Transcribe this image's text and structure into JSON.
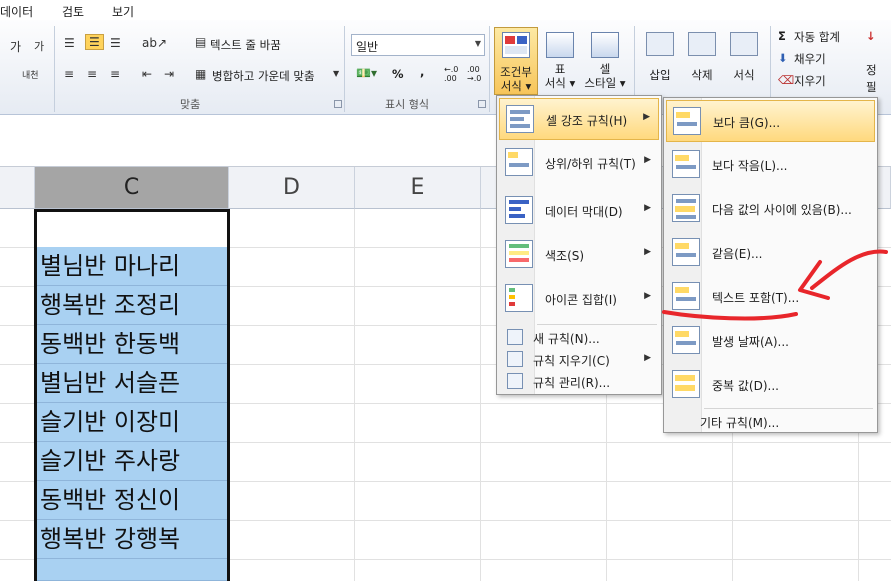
{
  "menubar": {
    "tabs": [
      "데이터",
      "검토",
      "보기"
    ]
  },
  "ribbon": {
    "font_group": {
      "bold_glyph": "가",
      "size_glyph": "가",
      "phonetic_glyph": "내천"
    },
    "alignment": {
      "wrap_text": "텍스트 줄 바꿈",
      "merge_center": "병합하고 가운데 맞춤",
      "group_label": "맞춤"
    },
    "number": {
      "format_value": "일반",
      "percent": "%",
      "comma": ",",
      "inc_decimal": "←.0 .00",
      "dec_decimal": ".00 →.0",
      "group_label": "표시 형식"
    },
    "styles": {
      "conditional_formatting": [
        "조건부",
        "서식 ▾"
      ],
      "format_as_table": [
        "표",
        "서식 ▾"
      ],
      "cell_styles": [
        "셀",
        "스타일 ▾"
      ]
    },
    "cells": {
      "insert": "삽입",
      "delete": "삭제",
      "format": "서식"
    },
    "editing": {
      "autosum": "자동 합계",
      "fill": "채우기",
      "clear": "지우기",
      "sort": [
        "정",
        "필"
      ]
    }
  },
  "sheet": {
    "columns": [
      "C",
      "D",
      "E"
    ],
    "cells": [
      "별님반 마나리",
      "행복반 조정리",
      "동백반 한동백",
      "별님반 서슬픈",
      "슬기반 이장미",
      "슬기반 주사랑",
      "동백반 정신이",
      "행복반 강행복"
    ]
  },
  "cf_menu": {
    "items": [
      {
        "label": "셀 강조 규칙(H)"
      },
      {
        "label": "상위/하위 규칙(T)"
      },
      {
        "label": "데이터 막대(D)"
      },
      {
        "label": "색조(S)"
      },
      {
        "label": "아이콘 집합(I)"
      }
    ],
    "small_items": [
      "새 규칙(N)...",
      "규칙 지우기(C)",
      "규칙 관리(R)..."
    ]
  },
  "highlight_submenu": {
    "items": [
      "보다 큼(G)...",
      "보다 작음(L)...",
      "다음 값의 사이에 있음(B)...",
      "같음(E)...",
      "텍스트 포함(T)...",
      "발생 날짜(A)...",
      "중복 값(D)..."
    ],
    "more": "기타 규칙(M)..."
  },
  "colors": {
    "accent_red": "#e8262b",
    "selection_fill": "#a9d1f2",
    "menu_highlight": "#ffd97e"
  }
}
